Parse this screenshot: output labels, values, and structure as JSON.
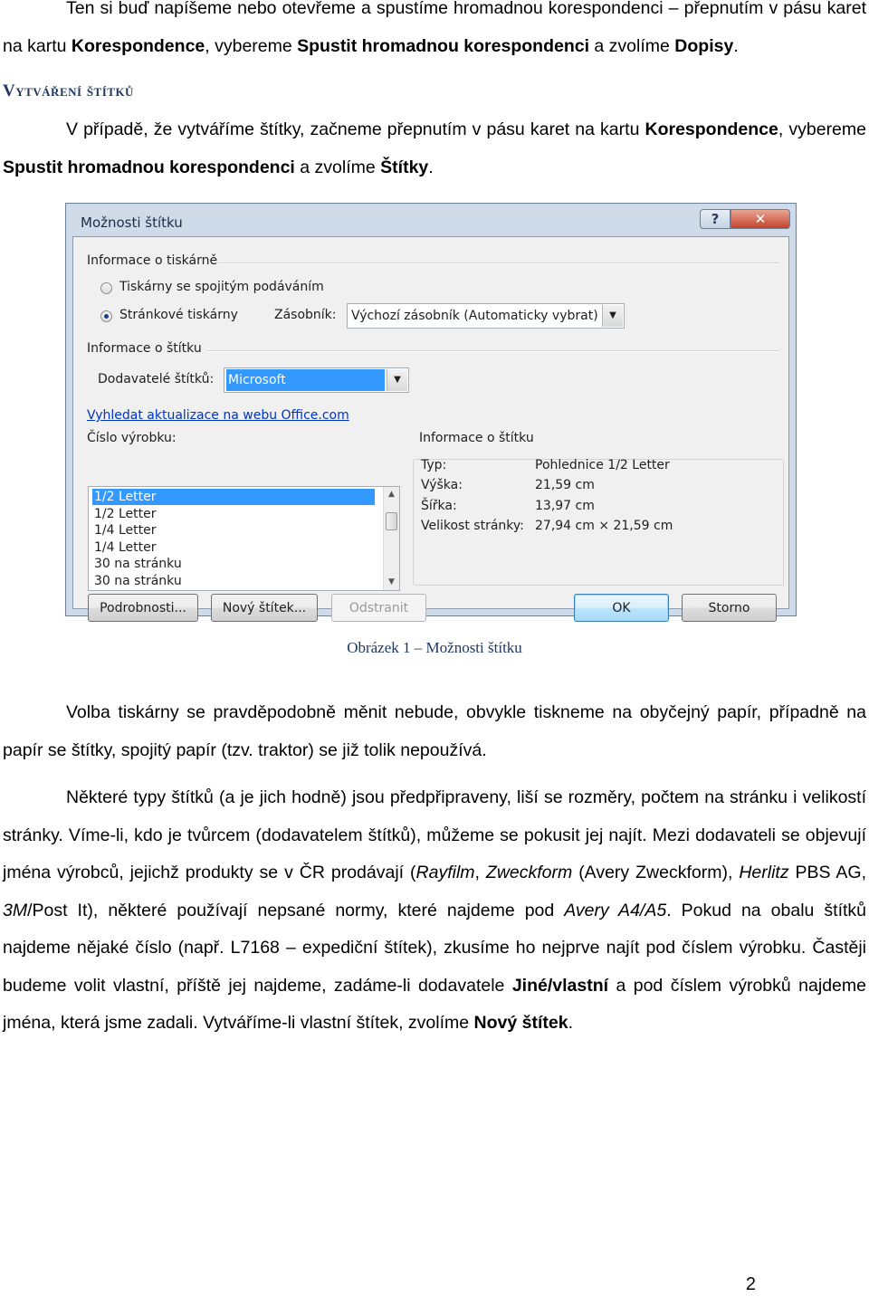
{
  "paragraph1": {
    "t1": "Ten si buď napíšeme nebo otevřeme a spustíme hromadnou korespondenci – přepnutím v pásu karet na kartu ",
    "b1": "Korespondence",
    "t2": ", vybereme ",
    "b2": "Spustit hromadnou korespondenci",
    "t3": " a zvolíme ",
    "b3": "Dopisy",
    "t4": "."
  },
  "heading": "Vytváření štítků",
  "paragraph2": {
    "t1": "V případě, že vytváříme štítky, začneme přepnutím v pásu karet na kartu ",
    "b1": "Korespondence",
    "t2": ", vybereme ",
    "b2": "Spustit hromadnou korespondenci",
    "t3": " a zvolíme ",
    "b3": "Štítky",
    "t4": "."
  },
  "dialog": {
    "title": "Možnosti štítku",
    "help_glyph": "?",
    "close_glyph": "✕",
    "printer_group": "Informace o tiskárně",
    "radio_continuous": "Tiskárny se spojitým podáváním",
    "radio_page": "Stránkové tiskárny",
    "tray_label": "Zásobník:",
    "tray_value": "Výchozí zásobník (Automaticky vybrat)",
    "label_group": "Informace o štítku",
    "vendor_label": "Dodavatelé štítků:",
    "vendor_value": "Microsoft",
    "update_link": "Vyhledat aktualizace na webu Office.com",
    "product_label": "Číslo výrobku:",
    "products": [
      "1/2 Letter",
      "1/2 Letter",
      "1/4 Letter",
      "1/4 Letter",
      "30 na stránku",
      "30 na stránku"
    ],
    "info_title": "Informace o štítku",
    "info": {
      "type_label": "Typ:",
      "type_value": "Pohlednice 1/2 Letter",
      "height_label": "Výška:",
      "height_value": "21,59 cm",
      "width_label": "Šířka:",
      "width_value": "13,97 cm",
      "page_label": "Velikost stránky:",
      "page_value": "27,94 cm × 21,59 cm"
    },
    "buttons": {
      "details": "Podrobnosti...",
      "new_label": "Nový štítek...",
      "delete": "Odstranit",
      "ok": "OK",
      "cancel": "Storno"
    }
  },
  "caption": "Obrázek 1 – Možnosti štítku",
  "paragraph3": "Volba tiskárny se pravděpodobně měnit nebude, obvykle tiskneme na obyčejný papír, případně na papír se štítky, spojitý papír (tzv. traktor) se již tolik nepoužívá.",
  "paragraph4": {
    "t1": "Některé typy štítků (a je jich hodně) jsou předpřipraveny, liší se rozměry, počtem na stránku i velikostí stránky. Víme-li, kdo je tvůrcem (dodavatelem štítků), můžeme se pokusit jej najít. Mezi dodavateli se objevují jména výrobců, jejichž produkty se v ČR prodávají (",
    "i1": "Rayfilm",
    "t2": ", ",
    "i2": "Zweckform",
    "t3": " (Avery Zweckform), ",
    "i3": "Herlitz",
    "t4": " PBS AG, ",
    "i4": "3M",
    "t5": "/Post It), některé používají nepsané normy, které najdeme pod ",
    "i5": "Avery A4/A5",
    "t6": ". Pokud na obalu štítků najdeme nějaké číslo (např. L7168 – expediční štítek), zkusíme ho nejprve najít pod číslem výrobku. Častěji budeme volit vlastní, příště jej najdeme, zadáme-li dodavatele ",
    "b1": "Jiné/vlastní",
    "t7": " a pod číslem výrobků najdeme jména, která jsme zadali. Vytváříme-li vlastní štítek, zvolíme ",
    "b2": "Nový štítek",
    "t8": "."
  },
  "page_number": "2"
}
